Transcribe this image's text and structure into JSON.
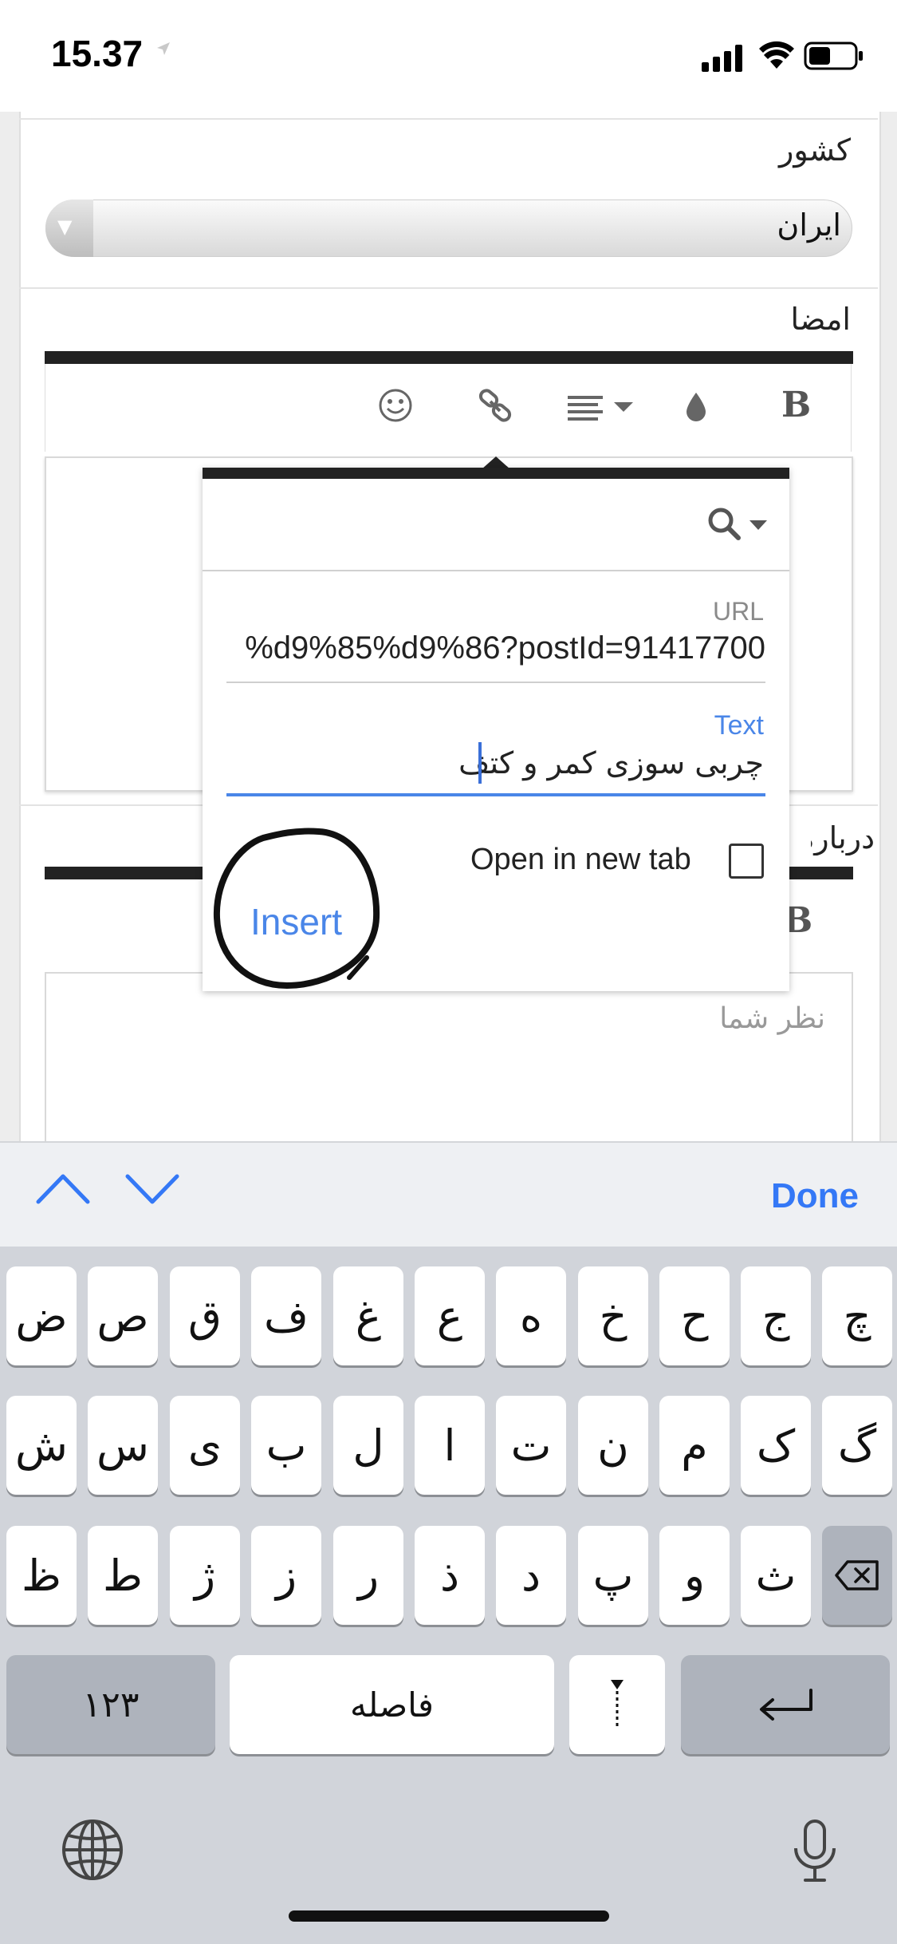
{
  "status_bar": {
    "time": "15.37"
  },
  "form": {
    "country_label": "کشور",
    "country_value": "ایران",
    "signature_label": "امضا",
    "about_label": "درباره",
    "comment_placeholder": "نظر شما"
  },
  "toolbar": {
    "icons": [
      "bold-icon",
      "color-drop-icon",
      "align-icon",
      "link-icon",
      "emoji-icon"
    ],
    "bold_glyph": "B"
  },
  "link_dialog": {
    "url_label": "URL",
    "url_value": "%d9%85%d9%86?postId=91417700",
    "text_label": "Text",
    "text_value": "چربی سوزی کمر و کتف",
    "open_new_tab_label": "Open in new tab",
    "open_new_tab_checked": false,
    "insert_label": "Insert"
  },
  "accessory": {
    "done_label": "Done"
  },
  "keyboard": {
    "row1": [
      "ض",
      "ص",
      "ق",
      "ف",
      "غ",
      "ع",
      "ه",
      "خ",
      "ح",
      "ج",
      "چ"
    ],
    "row2": [
      "ش",
      "س",
      "ی",
      "ب",
      "ل",
      "ا",
      "ت",
      "ن",
      "م",
      "ک",
      "گ"
    ],
    "row3": [
      "ظ",
      "ط",
      "ژ",
      "ز",
      "ر",
      "ذ",
      "د",
      "پ",
      "و",
      "ث"
    ],
    "numbers_label": "۱۲۳",
    "space_label": "فاصله"
  },
  "colors": {
    "accent": "#4a86e8",
    "done": "#3478f6",
    "toolbar_bar": "#222222"
  }
}
